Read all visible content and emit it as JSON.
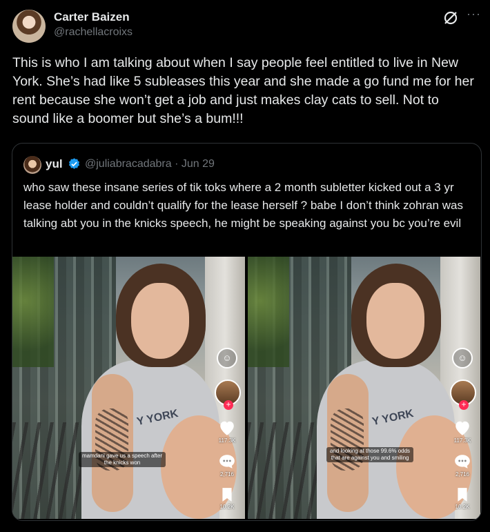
{
  "post": {
    "author_name": "Carter Baizen",
    "author_handle": "@rachellacroixs",
    "text": "This is who I am talking about when I say people feel entitled to live in New York. She’s had like 5 subleases this year and she made a go fund me for her rent because she won’t get a job and just makes clay cats to sell. Not to sound like a boomer but she’s a bum!!!",
    "more_label": "···",
    "icons": [
      "grok-icon",
      "more-icon"
    ]
  },
  "quote": {
    "author_name": "yul",
    "author_handle": "@juliabracadabra · Jun 29",
    "text": "who saw these insane series of tik toks where a 2 month subletter kicked out a 3 yr lease holder and couldn’t qualify for the lease herself ? babe I don’t think zohran was talking abt you in the knicks speech, he might be speaking against you bc you’re evil",
    "verified_color": "#1d9bf0",
    "media": [
      {
        "caption": "mamdani gave us a speech after the knicks won",
        "shirt_text": "Y YORK",
        "likes": "117.3K",
        "comments": "2,716",
        "saves": "10.2K"
      },
      {
        "caption": "and looking at those 99.6% odds that are against you and smiling",
        "shirt_text": "Y YORK",
        "likes": "117.3K",
        "comments": "2,716",
        "saves": "10.2K"
      }
    ]
  },
  "colors": {
    "background": "#000000",
    "text": "#e7e9ea",
    "muted": "#71767b",
    "border": "#2f3336",
    "tiktok_red": "#fe2c55"
  }
}
